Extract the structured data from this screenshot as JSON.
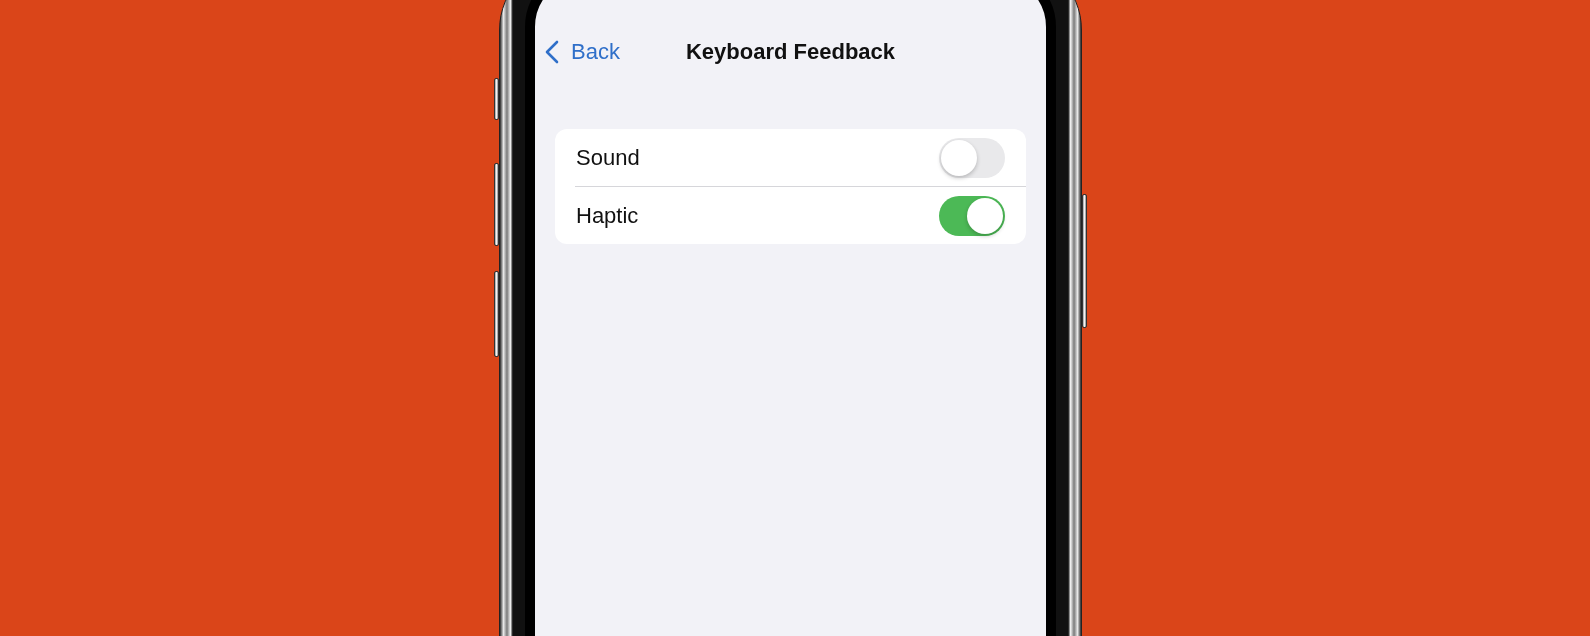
{
  "nav": {
    "back": "Back",
    "title": "Keyboard Feedback"
  },
  "settings": [
    {
      "label": "Sound",
      "on": false
    },
    {
      "label": "Haptic",
      "on": true
    }
  ]
}
